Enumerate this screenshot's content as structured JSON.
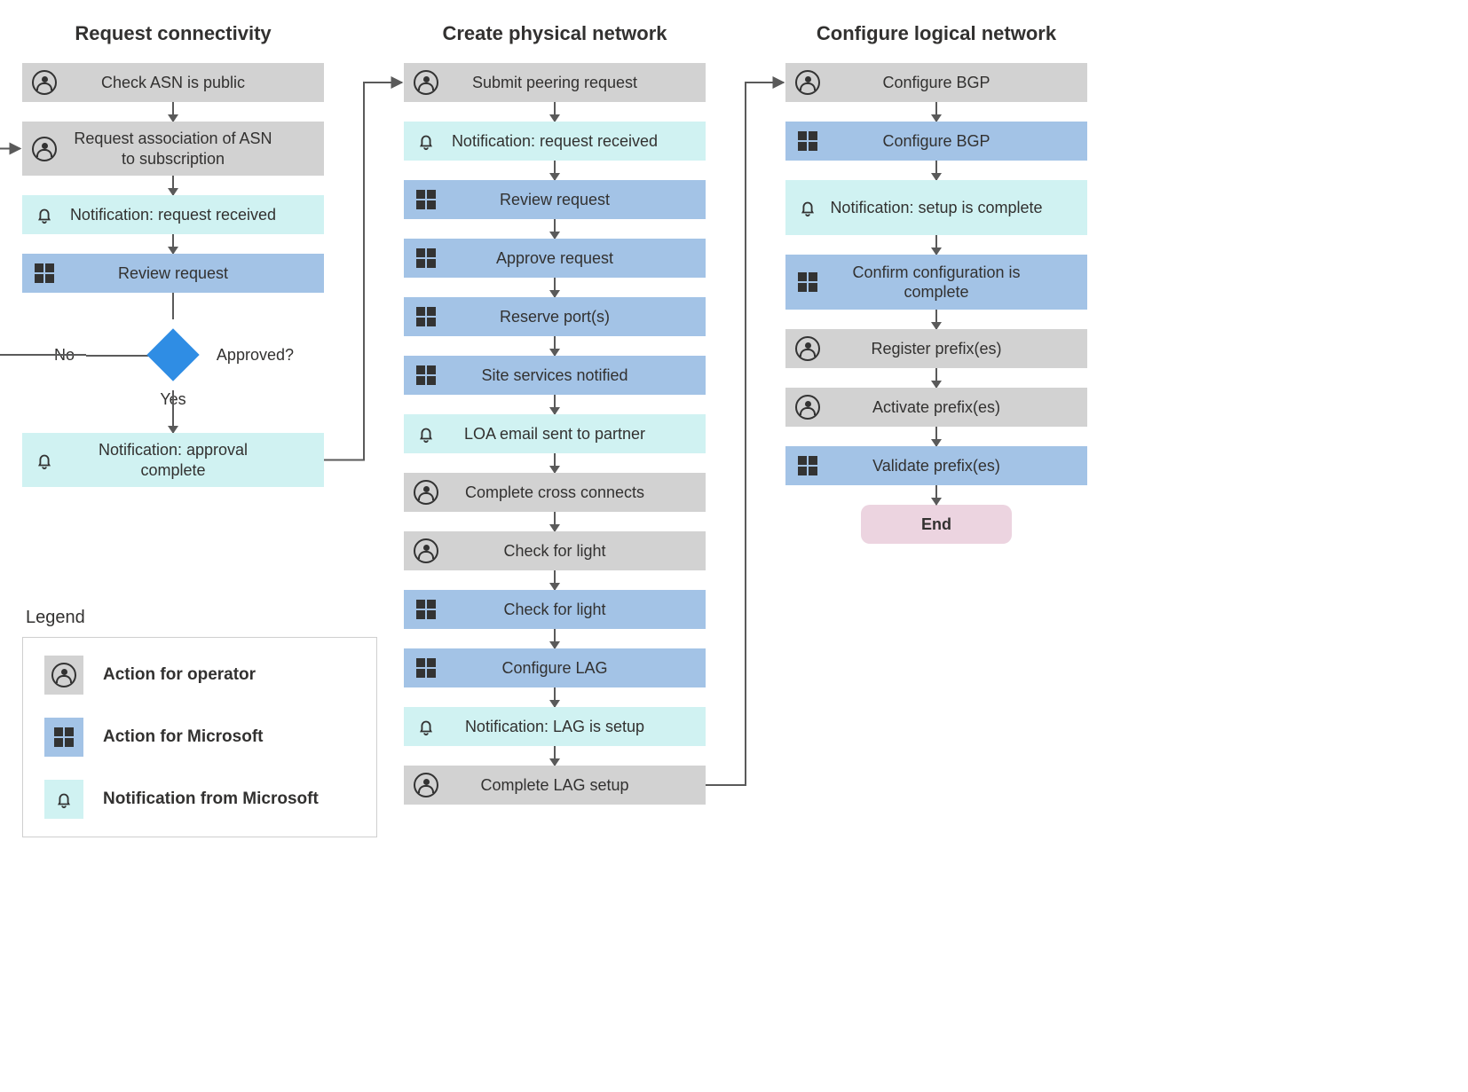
{
  "columns": [
    {
      "title": "Request connectivity",
      "steps": [
        {
          "type": "operator",
          "label": "Check ASN is public"
        },
        {
          "type": "operator",
          "label": "Request association of ASN to subscription"
        },
        {
          "type": "notification",
          "label": "Notification: request received"
        },
        {
          "type": "microsoft",
          "label": "Review request"
        }
      ],
      "decision": {
        "question": "Approved?",
        "yes": "Yes",
        "no": "No"
      },
      "after_decision": [
        {
          "type": "notification",
          "label": "Notification: approval complete"
        }
      ]
    },
    {
      "title": "Create physical network",
      "steps": [
        {
          "type": "operator",
          "label": "Submit peering request"
        },
        {
          "type": "notification",
          "label": "Notification: request received"
        },
        {
          "type": "microsoft",
          "label": "Review request"
        },
        {
          "type": "microsoft",
          "label": "Approve request"
        },
        {
          "type": "microsoft",
          "label": "Reserve port(s)"
        },
        {
          "type": "microsoft",
          "label": "Site services notified"
        },
        {
          "type": "notification",
          "label": "LOA email sent to partner"
        },
        {
          "type": "operator",
          "label": "Complete cross connects"
        },
        {
          "type": "operator",
          "label": "Check for light"
        },
        {
          "type": "microsoft",
          "label": "Check for light"
        },
        {
          "type": "microsoft",
          "label": "Configure LAG"
        },
        {
          "type": "notification",
          "label": "Notification: LAG is setup"
        },
        {
          "type": "operator",
          "label": "Complete LAG setup"
        }
      ]
    },
    {
      "title": "Configure logical network",
      "steps": [
        {
          "type": "operator",
          "label": "Configure BGP"
        },
        {
          "type": "microsoft",
          "label": "Configure BGP"
        },
        {
          "type": "notification",
          "label": "Notification: setup is complete"
        },
        {
          "type": "microsoft",
          "label": "Confirm configuration is complete"
        },
        {
          "type": "operator",
          "label": "Register prefix(es)"
        },
        {
          "type": "operator",
          "label": "Activate prefix(es)"
        },
        {
          "type": "microsoft",
          "label": "Validate prefix(es)"
        }
      ],
      "end_label": "End"
    }
  ],
  "legend": {
    "title": "Legend",
    "items": [
      {
        "type": "operator",
        "label": "Action for operator"
      },
      {
        "type": "microsoft",
        "label": "Action for Microsoft"
      },
      {
        "type": "notification",
        "label": "Notification from Microsoft"
      }
    ]
  }
}
